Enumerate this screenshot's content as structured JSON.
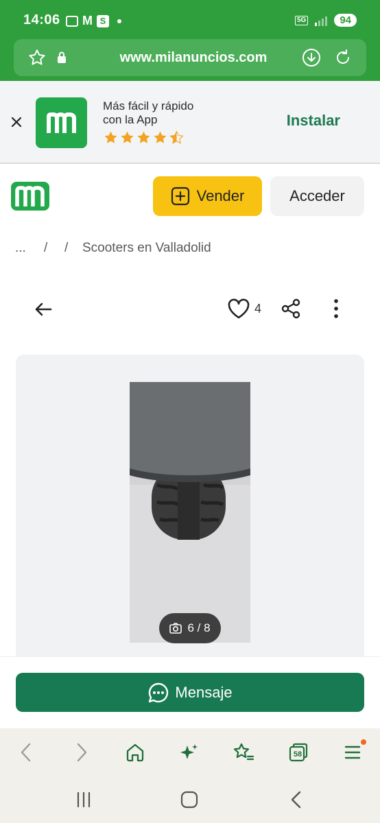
{
  "status_bar": {
    "time": "14:06",
    "network": "5G",
    "battery": "94",
    "left_icons": [
      "screenshot-icon",
      "gmail-icon",
      "s-app-icon",
      "dot-icon"
    ]
  },
  "browser": {
    "url": "www.milanuncios.com",
    "tabs_count": "58"
  },
  "app_banner": {
    "line1": "Más fácil y rápido",
    "line2": "con la App",
    "rating_stars": 4.5,
    "install_label": "Instalar"
  },
  "header": {
    "logo_letter": "m",
    "sell_label": "Vender",
    "login_label": "Acceder"
  },
  "breadcrumb": {
    "items": [
      "...",
      "/",
      "/",
      "Scooters en Valladolid"
    ]
  },
  "listing_actions": {
    "favorites_count": "4"
  },
  "gallery": {
    "counter": "6 / 8"
  },
  "message_button": {
    "label": "Mensaje"
  },
  "colors": {
    "brand_green": "#2f9e3c",
    "app_green": "#23a84c",
    "cta_green": "#187a52",
    "vender_yellow": "#f8c212",
    "star_orange": "#f3a321"
  }
}
